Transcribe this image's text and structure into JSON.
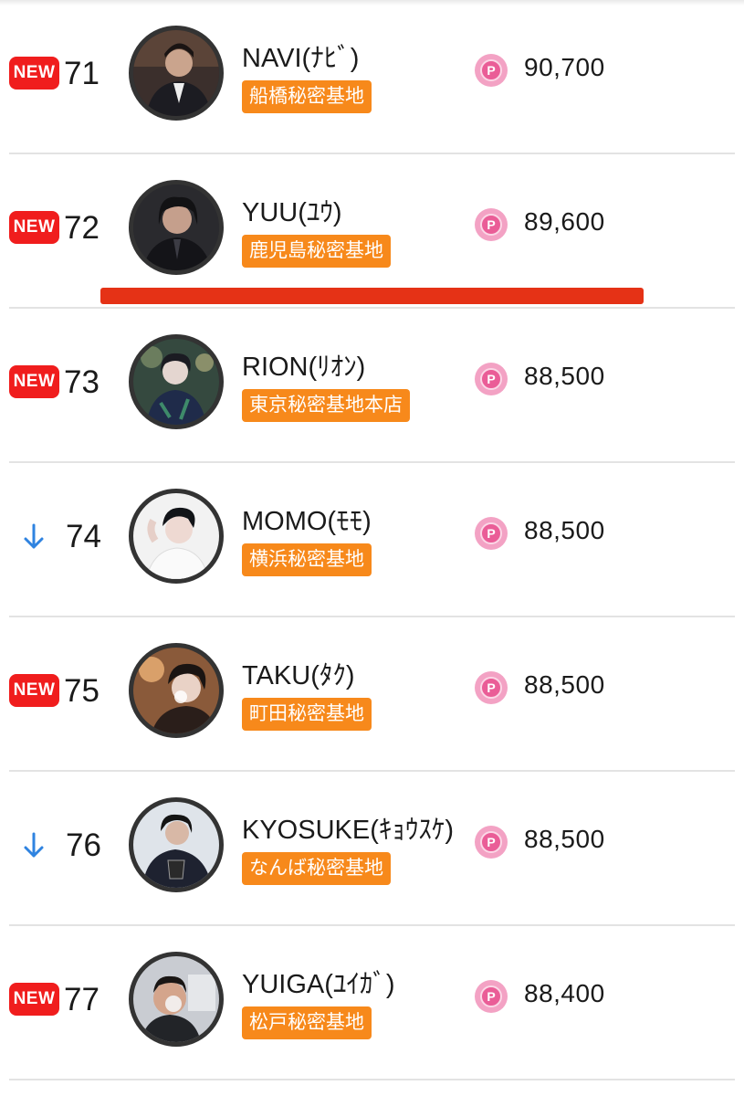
{
  "new_badge_text": "NEW",
  "points_icon_glyph": "P",
  "colors": {
    "new_badge": "#f01d1d",
    "store_tag": "#f7891b",
    "points_icon": "#ea5d97",
    "down_arrow": "#2f83e0",
    "marker_line": "#e53216"
  },
  "ranking": [
    {
      "rank": "71",
      "status": "new",
      "name": "NAVI(ﾅﾋﾞ)",
      "store": "船橋秘密基地",
      "points": "90,700"
    },
    {
      "rank": "72",
      "status": "new",
      "name": "YUU(ﾕｳ)",
      "store": "鹿児島秘密基地",
      "points": "89,600"
    },
    {
      "rank": "73",
      "status": "new",
      "name": "RION(ﾘｵﾝ)",
      "store": "東京秘密基地本店",
      "points": "88,500"
    },
    {
      "rank": "74",
      "status": "down",
      "name": "MOMO(ﾓﾓ)",
      "store": "横浜秘密基地",
      "points": "88,500"
    },
    {
      "rank": "75",
      "status": "new",
      "name": "TAKU(ﾀｸ)",
      "store": "町田秘密基地",
      "points": "88,500"
    },
    {
      "rank": "76",
      "status": "down",
      "name": "KYOSUKE(ｷｮｳｽｹ)",
      "store": "なんば秘密基地",
      "points": "88,500"
    },
    {
      "rank": "77",
      "status": "new",
      "name": "YUIGA(ﾕｲｶﾞ)",
      "store": "松戸秘密基地",
      "points": "88,400"
    }
  ]
}
